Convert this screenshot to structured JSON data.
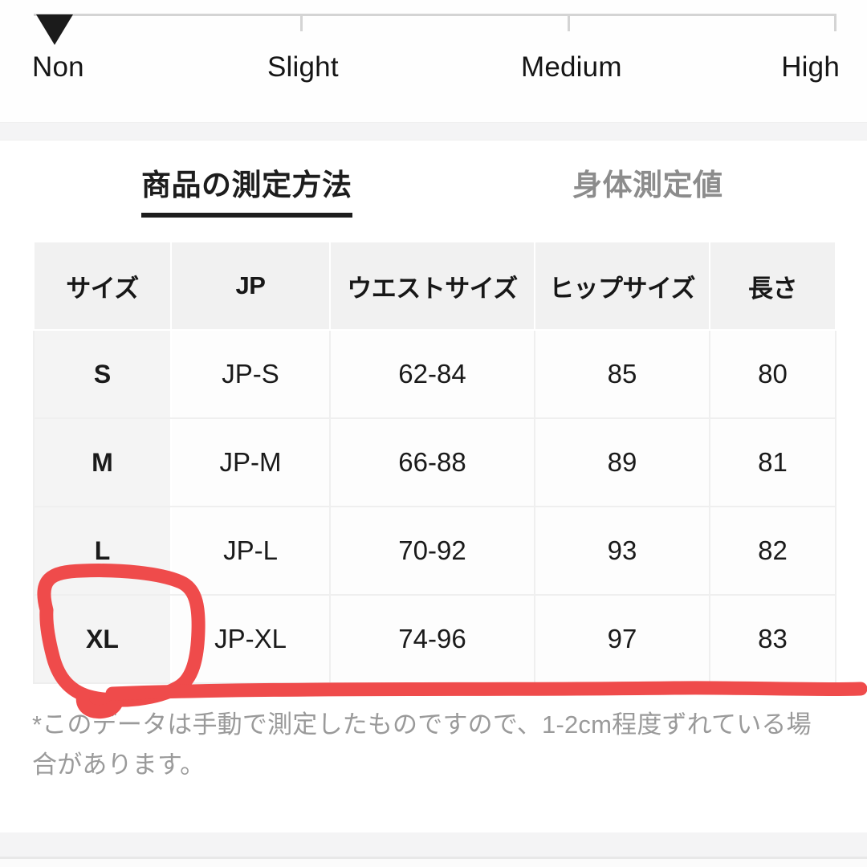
{
  "sheerness_scale": {
    "marker_position_label": "Non",
    "labels": [
      "Non",
      "Slight",
      "Medium",
      "High"
    ]
  },
  "tabs": [
    {
      "label": "商品の測定方法",
      "state": "active"
    },
    {
      "label": "身体測定値",
      "state": "inactive"
    }
  ],
  "size_table": {
    "headers": [
      "サイズ",
      "JP",
      "ウエストサイズ",
      "ヒップサイズ",
      "長さ"
    ],
    "rows": [
      {
        "size": "S",
        "jp": "JP-S",
        "waist": "62-84",
        "hip": "85",
        "length": "80"
      },
      {
        "size": "M",
        "jp": "JP-M",
        "waist": "66-88",
        "hip": "89",
        "length": "81"
      },
      {
        "size": "L",
        "jp": "JP-L",
        "waist": "70-92",
        "hip": "93",
        "length": "82"
      },
      {
        "size": "XL",
        "jp": "JP-XL",
        "waist": "74-96",
        "hip": "97",
        "length": "83"
      }
    ]
  },
  "footnote": {
    "text": "*このデータは手動で測定したものですので、1-2cm程度ずれている場合があります。"
  },
  "annotation": {
    "type": "hand-drawn-red-marker",
    "circled_cell": "XL",
    "color": "#ef4b4b",
    "description": "赤い手書きの丸印とXL行の下線"
  },
  "colors": {
    "marker_fill": "#1b1b1b",
    "track": "#d4d4d4",
    "active_tab": "#1d1d1d",
    "inactive_tab": "#8c8c8c",
    "header_bg": "#f1f1f1",
    "size_col_bg": "#f4f4f4",
    "footnote_text": "#9a9a9a",
    "annotation_red": "#ef4b4b"
  }
}
